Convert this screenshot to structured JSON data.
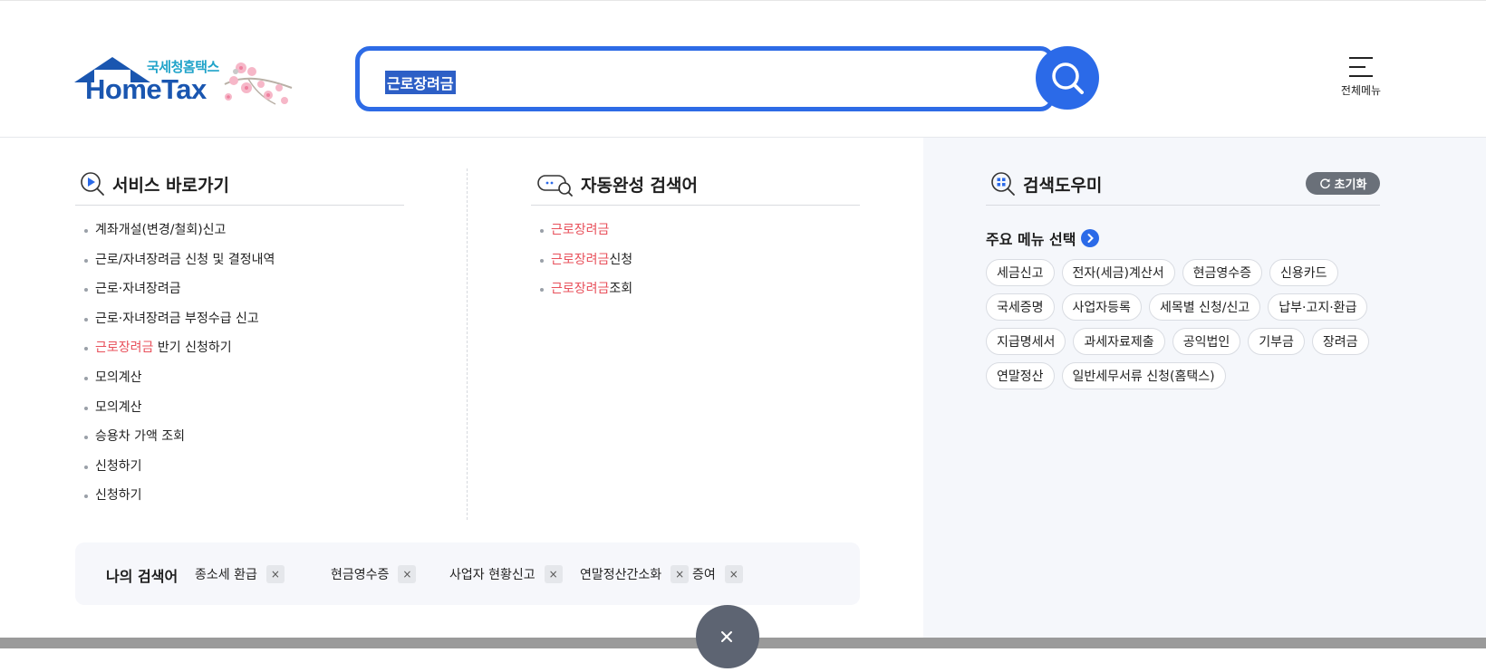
{
  "header": {
    "logo_sub": "국세청홈택스",
    "logo_main": "HomeTax",
    "search_value": "근로장려금",
    "all_menu_label": "전체메뉴"
  },
  "services": {
    "title": "서비스 바로가기",
    "items": [
      {
        "pre": "",
        "hl": "",
        "post": "계좌개설(변경/철회)신고"
      },
      {
        "pre": "",
        "hl": "",
        "post": "근로/자녀장려금 신청 및 결정내역"
      },
      {
        "pre": "",
        "hl": "",
        "post": "근로·자녀장려금"
      },
      {
        "pre": "",
        "hl": "",
        "post": "근로·자녀장려금 부정수급 신고"
      },
      {
        "pre": "",
        "hl": "근로장려금",
        "post": " 반기 신청하기"
      },
      {
        "pre": "",
        "hl": "",
        "post": "모의계산"
      },
      {
        "pre": "",
        "hl": "",
        "post": "모의계산"
      },
      {
        "pre": "",
        "hl": "",
        "post": "승용차 가액 조회"
      },
      {
        "pre": "",
        "hl": "",
        "post": "신청하기"
      },
      {
        "pre": "",
        "hl": "",
        "post": "신청하기"
      }
    ]
  },
  "autocomplete": {
    "title": "자동완성 검색어",
    "items": [
      {
        "hl": "근로장려금",
        "post": ""
      },
      {
        "hl": "근로장려금",
        "post": "신청"
      },
      {
        "hl": "근로장려금",
        "post": "조회"
      }
    ]
  },
  "helper": {
    "title": "검색도우미",
    "reset_label": "초기화",
    "menu_select_label": "주요 메뉴 선택",
    "chips": [
      "세금신고",
      "전자(세금)계산서",
      "현금영수증",
      "신용카드",
      "국세증명",
      "사업자등록",
      "세목별 신청/신고",
      "납부·고지·환급",
      "지급명세서",
      "과세자료제출",
      "공익법인",
      "기부금",
      "장려금",
      "연말정산",
      "일반세무서류 신청(홈택스)"
    ]
  },
  "recent": {
    "title": "나의 검색어",
    "items": [
      "종소세 환급",
      "현금영수증",
      "사업자 현황신고",
      "연말정산간소화",
      "증여"
    ],
    "remove_glyph": "×"
  },
  "colors": {
    "accent": "#2b6ae8",
    "highlight": "#e8505b",
    "logo": "#1a56b0"
  }
}
